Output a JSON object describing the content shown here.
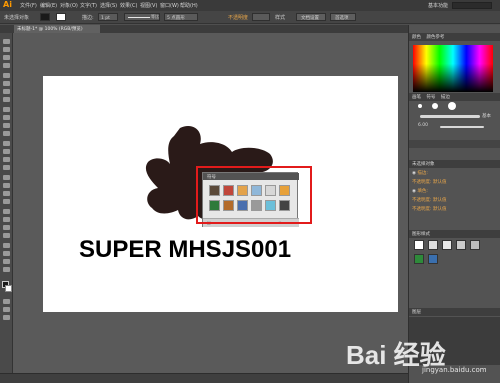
{
  "app": {
    "logo": "Ai"
  },
  "menubar": {
    "items": [
      "文件(F)",
      "编辑(E)",
      "对象(O)",
      "文字(T)",
      "选择(S)",
      "效果(C)",
      "视图(V)",
      "窗口(W)",
      "帮助(H)"
    ],
    "workspace": "基本功能"
  },
  "control_bar": {
    "selection": "未选择对象",
    "stroke_weight": "1 pt",
    "stroke_profile": "等比",
    "brush_size": "5 点圆形",
    "opacity_label": "不透明度",
    "style_label": "样式",
    "doc_setup": "文档设置",
    "prefs": "首选项"
  },
  "document": {
    "tab": "未标题-1* @ 100% (RGB/预览)"
  },
  "artwork": {
    "headline": "SUPER MHSJS001"
  },
  "symbols_panel": {
    "title": "符号",
    "swatch_colors": [
      "#5b4a3a",
      "#c0463a",
      "#e3a24a",
      "#8fb7d9",
      "#d7d7d7",
      "#e7a13a",
      "#2e7a3a",
      "#b36b2a",
      "#4a6fae",
      "#9a9a9a",
      "#6cbfd9",
      "#444444"
    ]
  },
  "right_panels": {
    "color_tab": "颜色",
    "color_ref_tab": "颜色参考",
    "brush_tab": "画笔",
    "symbols_tab": "符号",
    "stroke_tab": "描边",
    "brush_basic": "基本",
    "stroke_value": "6.00",
    "appearance_title": "未选择对象",
    "appearance_rows": [
      "描边:",
      "不透明度: 默认值",
      "填色:",
      "不透明度: 默认值",
      "不透明度: 默认值"
    ],
    "graphic_styles_tab": "图形样式",
    "layers_tab": "图层"
  },
  "watermark": {
    "text": "Bai 经验",
    "sub": "jingyan.baidu.com"
  }
}
